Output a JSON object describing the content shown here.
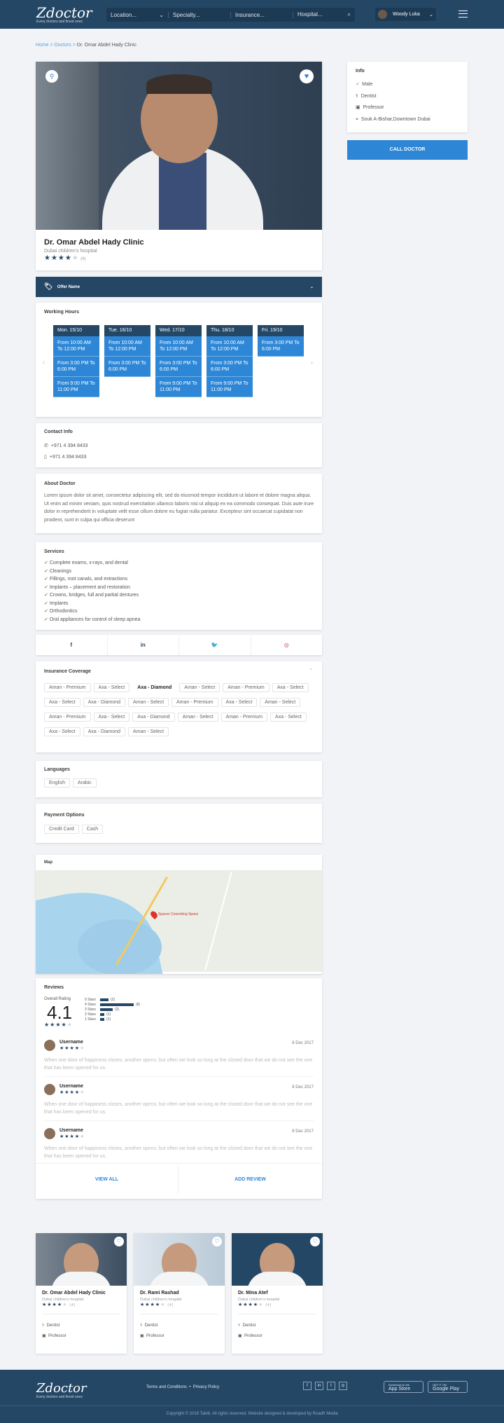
{
  "header": {
    "logo": "Zdoctor",
    "tagline": "Every doctors and finest ones",
    "location": "Location...",
    "specialty": "Specialty...",
    "insurance": "Insurance...",
    "hospital": "Hospital...",
    "user": "Woody Luka"
  },
  "crumbs": {
    "home": "Home",
    "doctors": "Doctors",
    "current": "Dr. Omar Abdel Hady Clinic"
  },
  "doctor": {
    "name": "Dr. Omar Abdel Hady Clinic",
    "hospital": "Dubai children's hospital",
    "reviews": "(4)",
    "rating": 4
  },
  "info": {
    "title": "Info",
    "gender": "Male",
    "specialty": "Dentist",
    "title2": "Professor",
    "address": "Souk A-Bishar,Downtown Dubai",
    "call": "CALL DOCTOR"
  },
  "offer": "Offer Name",
  "hours": {
    "title": "Working Hours",
    "days": [
      {
        "d": "Mon. 15/10",
        "s": [
          "From 10:00 AM To 12:00 PM",
          "From 3:00 PM To 6:00 PM",
          "From 9:00 PM To 11:00 PM"
        ]
      },
      {
        "d": "Tue. 16/10",
        "s": [
          "From 10:00 AM To 12:00 PM",
          "From 3:00 PM To 6:00 PM"
        ]
      },
      {
        "d": "Wed. 17/10",
        "s": [
          "From 10:00 AM To 12:00 PM",
          "From 3:00 PM To 6:00 PM",
          "From 9:00 PM To 11:00 PM"
        ]
      },
      {
        "d": "Thu. 18/10",
        "s": [
          "From 10:00 AM To 12:00 PM",
          "From 3:00 PM To 6:00 PM",
          "From 9:00 PM To 11:00 PM"
        ]
      },
      {
        "d": "Fri. 19/10",
        "s": [
          "From 3:00 PM To 6:00 PM"
        ]
      }
    ]
  },
  "contact": {
    "title": "Contact Info",
    "phone": "+971 4 394 8433",
    "mobile": "+971 4 394 8433"
  },
  "about": {
    "title": "About Doctor",
    "text": "Lorem ipsum dolor sit amet, consectetur adipiscing elit, sed do eiusmod tempor incididunt ut labore et dolore magna aliqua. Ut enim ad minim veniam, quis nostrud exercitation ullamco laboris nisi ut aliquip ex ea commodo consequat. Duis aute irure dolor in reprehenderit in voluptate velit esse cillum dolore eu fugiat nulla pariatur. Excepteur sint occaecat cupidatat non proident, sunt in culpa qui officia deserunt"
  },
  "services": {
    "title": "Services",
    "items": [
      "Complete exams, x-rays, and dental",
      "Cleanings",
      "Fillings, root canals, and extractions",
      "Implants – placement and restoration",
      "Crowns, bridges, full and partial dentures",
      "Implants",
      "Orthodontics",
      "Oral appliances for control of sleep apnea"
    ]
  },
  "social": {
    "f": "f",
    "in": "in",
    "tw": "🐦",
    "ig": "◎"
  },
  "insurance": {
    "title": "Insurance Coverage",
    "items": [
      "Aman - Premium",
      "Axa - Select",
      "Axa - Diamond",
      "Aman - Select",
      "Aman - Premium",
      "Axa - Select",
      "Axa - Select",
      "Axa - Diamond",
      "Aman - Select",
      "Aman - Premium",
      "Axa - Select",
      "Aman - Select",
      "Aman - Premium",
      "Axa - Select",
      "Axa - Diamond",
      "Aman - Select",
      "Aman - Premium",
      "Axa - Select",
      "Axa - Select",
      "Axa - Diamond",
      "Aman - Select"
    ]
  },
  "languages": {
    "title": "Languages",
    "items": [
      "English",
      "Arabic"
    ]
  },
  "payment": {
    "title": "Payment Options",
    "items": [
      "Credit Card",
      "Cash"
    ]
  },
  "map": {
    "title": "Map",
    "marker": "Spaces Coworking Space"
  },
  "reviews": {
    "title": "Reviews",
    "overall": "Overall Rating",
    "score": "4.1",
    "bars": [
      {
        "l": "5 Stars",
        "n": "(2)",
        "v": 2
      },
      {
        "l": "4 Stars",
        "n": "(8)",
        "v": 8
      },
      {
        "l": "3 Stars",
        "n": "(3)",
        "v": 3
      },
      {
        "l": "2 Stars",
        "n": "(1)",
        "v": 1
      },
      {
        "l": "1 Stars",
        "n": "(1)",
        "v": 1
      }
    ],
    "list": [
      {
        "u": "Username",
        "d": "8 Dec 2017",
        "t": "When one door of happiness closes, another opens; but often we look so long at the closed door that we do not see the one that has been opened for us."
      },
      {
        "u": "Username",
        "d": "8 Dec 2017",
        "t": "When one door of happiness closes, another opens; but often we look so long at the closed door that we do not see the one that has been opened for us."
      },
      {
        "u": "Username",
        "d": "8 Dec 2017",
        "t": "When one door of happiness closes, another opens; but often we look so long at the closed door that we do not see the one that has been opened for us."
      }
    ],
    "view_all": "VIEW ALL",
    "add": "ADD REVIEW"
  },
  "related": [
    {
      "n": "Dr. Omar Abdel Hady Clinic",
      "h": "Dubai children's hospital",
      "r": "(4)",
      "s": "Dentist",
      "p": "Professor"
    },
    {
      "n": "Dr. Rami Rashad",
      "h": "Dubai children's hospital",
      "r": "(4)",
      "s": "Dentist",
      "p": "Professor"
    },
    {
      "n": "Dr. Mina Atef",
      "h": "Dubai children's hospital",
      "r": "(4)",
      "s": "Dentist",
      "p": "Professor"
    }
  ],
  "footer": {
    "terms": "Terms and Conditions",
    "privacy": "Privacy Policy",
    "appstore": "App Store",
    "appstore_small": "Download on the",
    "gplay": "Google Play",
    "gplay_small": "GET IT ON",
    "copy": "Copyright © 2018 Tabib. All rights reserved. Website designed & developed by Roadfr Media"
  }
}
